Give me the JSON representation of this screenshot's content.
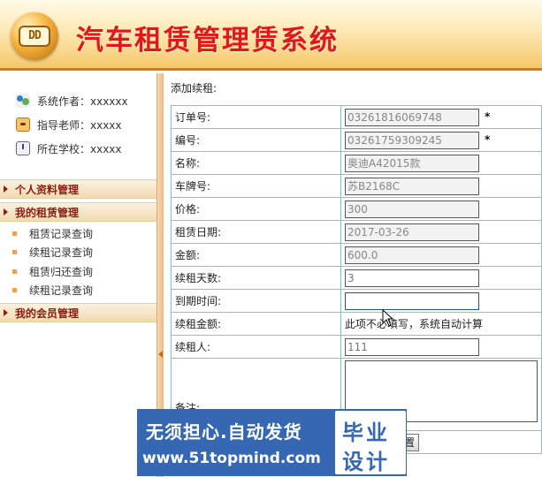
{
  "header": {
    "logo_text": "DD",
    "title": "汽车租赁管理赁系统"
  },
  "sidebar": {
    "info": [
      {
        "label": "系统作者：xxxxxx"
      },
      {
        "label": "指导老师：xxxxx"
      },
      {
        "label": "所在学校：xxxxx"
      }
    ],
    "menus": [
      {
        "title": "个人资料管理"
      },
      {
        "title": "我的租赁管理",
        "items": [
          "租赁记录查询",
          "续租记录查询",
          "租赁归还查询",
          "续租记录查询"
        ]
      },
      {
        "title": "我的会员管理"
      }
    ]
  },
  "main": {
    "section_title": "添加续租:",
    "fields": [
      {
        "label": "订单号:",
        "value": "03261816069748",
        "required": "*"
      },
      {
        "label": "编号:",
        "value": "03261759309245",
        "required": "*"
      },
      {
        "label": "名称:",
        "value": "奥迪A42015款"
      },
      {
        "label": "车牌号:",
        "value": "苏B2168C"
      },
      {
        "label": "价格:",
        "value": "300"
      },
      {
        "label": "租赁日期:",
        "value": "2017-03-26"
      },
      {
        "label": "金额:",
        "value": "600.0"
      },
      {
        "label": "续租天数:",
        "value": "3"
      },
      {
        "label": "到期时间:",
        "value": ""
      },
      {
        "label": "续租金额:",
        "text": "此项不必填写，系统自动计算"
      },
      {
        "label": "续租人:",
        "value": "111"
      },
      {
        "label": "备注:",
        "value": ""
      }
    ],
    "buttons": {
      "reset": "重置"
    }
  },
  "watermark": {
    "line1": "无须担心.自动发货",
    "line2": "www.51topmind.com",
    "box_line1": "毕业",
    "box_line2": "设计"
  },
  "colors": {
    "title_red": "#e0171b",
    "accent_orange": "#d07b1a",
    "table_border": "#6ad0d8",
    "watermark_blue": "#3567b3"
  }
}
